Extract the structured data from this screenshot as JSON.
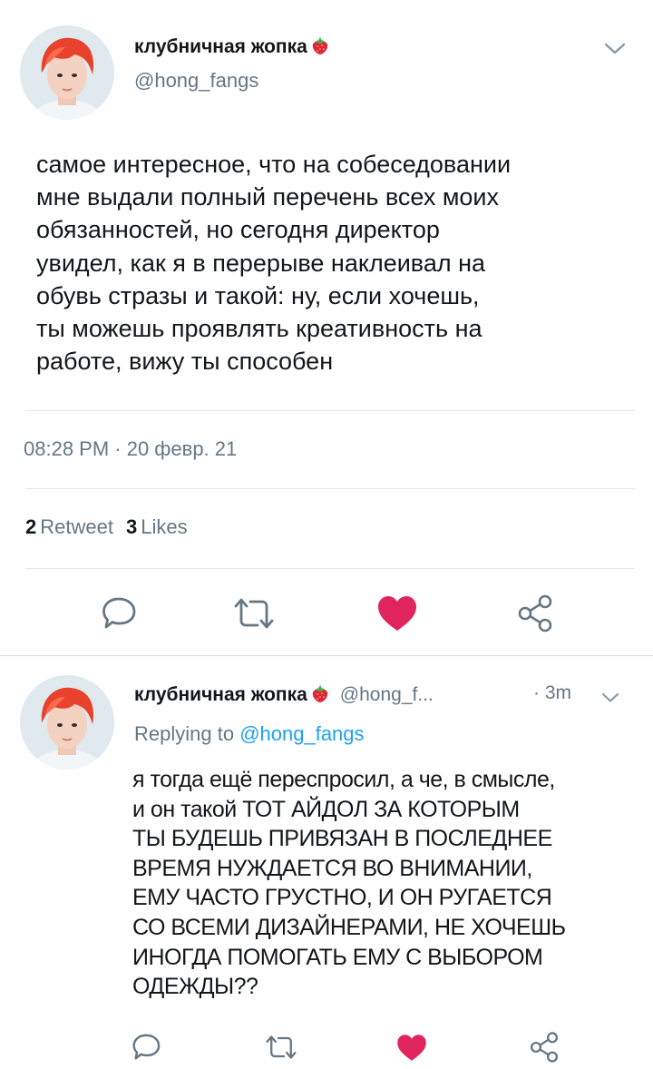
{
  "tweet": {
    "display_name": "клубничная жопка",
    "handle": "@hong_fangs",
    "text": "самое интересное, что на собеседовании\nмне выдали полный перечень всех моих\nобязанностей, но сегодня директор\nувидел, как я в перерыве наклеивал на\nобувь стразы и такой: ну, если хочешь,\nты можешь проявлять креативность на\nработе, вижу ты способен",
    "timestamp": "08:28 PM · 20 февр. 21",
    "retweet_count": "2",
    "retweet_label": "Retweet",
    "like_count": "3",
    "like_label": "Likes",
    "liked": true
  },
  "reply": {
    "display_name": "клубничная жопка",
    "handle": "@hong_f...",
    "time": "· 3m",
    "replying_label": "Replying to",
    "replying_to": "@hong_fangs",
    "text": "я тогда ещё переспросил, а че, в смысле,\nи он такой ТОТ АЙДОЛ ЗА КОТОРЫМ\nТЫ БУДЕШЬ ПРИВЯЗАН В ПОСЛЕДНЕЕ\nВРЕМЯ НУЖДАЕТСЯ ВО ВНИМАНИИ,\nЕМУ ЧАСТО ГРУСТНО, И ОН РУГАЕТСЯ\nСО ВСЕМИ ДИЗАЙНЕРАМИ, НЕ ХОЧЕШЬ\nИНОГДА ПОМОГАТЬ ЕМУ С ВЫБОРОМ\nОДЕЖДЫ??",
    "liked": true
  },
  "icons": {
    "name_emoji": "strawberry-icon",
    "menu": "chevron-down-icon",
    "reply": "reply-icon",
    "retweet": "retweet-icon",
    "like": "heart-icon",
    "share": "share-icon"
  },
  "colors": {
    "text": "#14171a",
    "secondary": "#657786",
    "link": "#1da1f2",
    "like": "#e0245e",
    "divider": "#e1e8ed",
    "avatar_hair": "#e8412c"
  }
}
